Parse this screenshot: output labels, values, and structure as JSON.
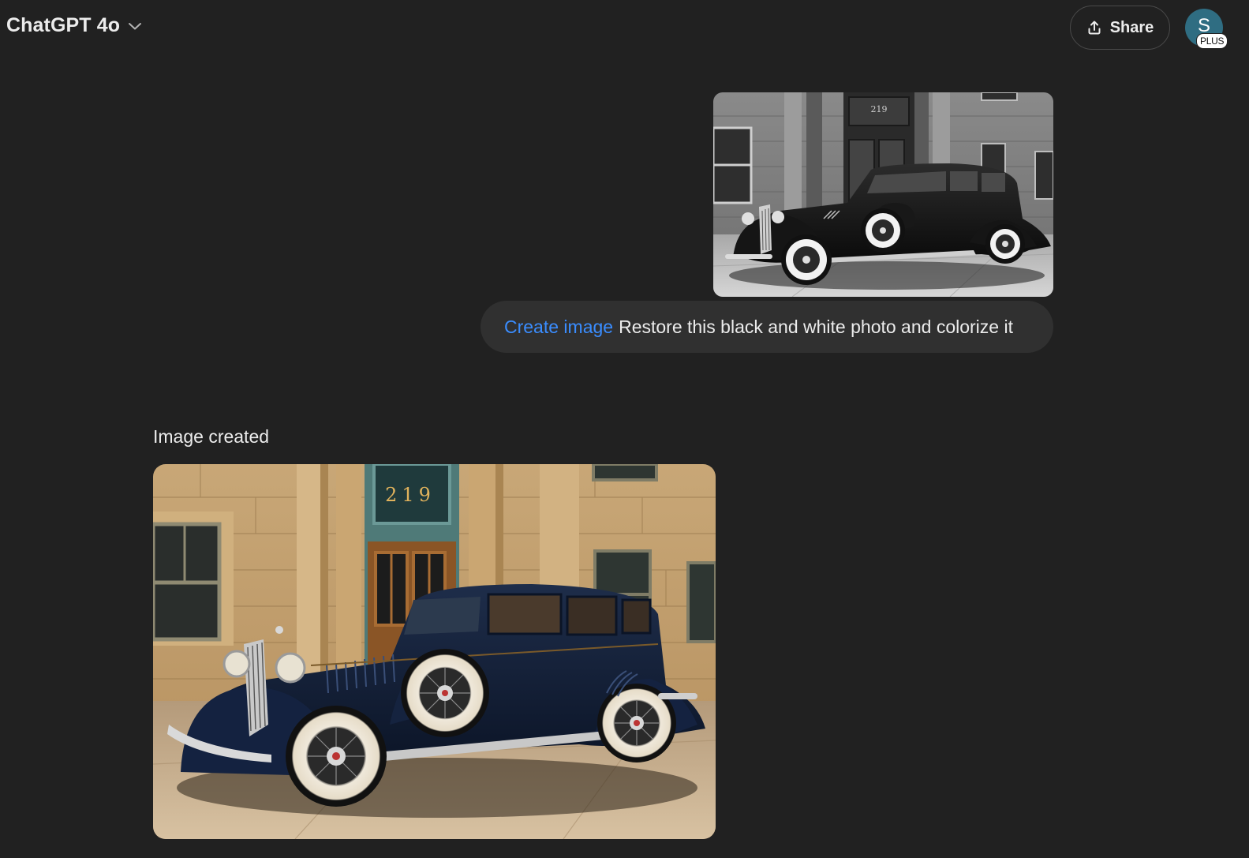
{
  "header": {
    "model_name": "ChatGPT 4o",
    "share_label": "Share",
    "avatar_initial": "S",
    "plan_badge": "PLUS"
  },
  "conversation": {
    "user_message": {
      "tool_chip": "Create image",
      "text": "Restore this black and white photo and colorize it",
      "attachment": {
        "description": "black-and-white-vintage-car-photo",
        "building_number": "219"
      }
    },
    "assistant_message": {
      "status": "Image created",
      "generated_image": {
        "description": "colorized-vintage-car-photo",
        "building_number": "219"
      }
    }
  },
  "colors": {
    "background": "#212121",
    "bubble": "#303030",
    "chip_blue": "#3a8dff",
    "avatar": "#2f6d82"
  }
}
